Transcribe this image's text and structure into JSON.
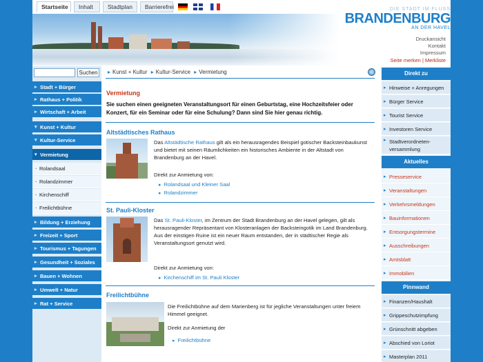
{
  "topnav": {
    "tabs": [
      "Startseite",
      "Inhalt",
      "Stadtplan",
      "Barrierefrei"
    ],
    "flags": [
      "flag-de-icon",
      "flag-uk-icon",
      "flag-fr-icon"
    ]
  },
  "logo": {
    "top": "DIE STADT IM FLUSS",
    "brand": "BRANDENBURG",
    "sub": "AN DER HAVEL"
  },
  "utility": [
    "Druckansicht",
    "Kontakt",
    "Impressum"
  ],
  "merk": {
    "a": "Seite merken",
    "sep": "|",
    "b": "Merkliste"
  },
  "search": {
    "button": "Suchen"
  },
  "leftnav": {
    "top": [
      "Stadt + Bürger",
      "Rathaus + Politik",
      "Wirtschaft + Arbeit",
      "Kunst + Kultur",
      "Kultur-Service",
      "Vermietung"
    ],
    "sub": [
      "Rolandsaal",
      "Rolandzimmer",
      "Kirchenschiff",
      "Freilichtbühne"
    ],
    "bottom": [
      "Bildung + Erziehung",
      "Freizeit + Sport",
      "Tourismus + Tagungen",
      "Gesundheit + Soziales",
      "Bauen + Wohnen",
      "Umwelt + Natur",
      "Rat + Service"
    ]
  },
  "breadcrumb": [
    "Kunst + Kultur",
    "Kultur-Service",
    "Vermietung"
  ],
  "main": {
    "title": "Vermietung",
    "intro": "Sie suchen einen geeigneten Veranstaltungsort für einen Geburtstag, eine Hochzeitsfeier oder Konzert, für ein Seminar oder für eine Schulung? Dann sind Sie hier genau richtig.",
    "s1": {
      "title": "Altstädtisches Rathaus",
      "pre": "Das ",
      "link": "Altstädtische Rathaus",
      "post": " gilt als ein herausragendes Beispiel gotischer Backsteinbaukunst und bietet mit seinen Räumlichkeiten ein historisches Ambiente in der Altstadt von Brandenburg an der Havel.",
      "direkt": "Direkt zur Anmietung von:",
      "links": [
        "Rolandsaal und Kleiner Saal",
        "Rolandzimmer"
      ]
    },
    "s2": {
      "title": "St. Pauli-Kloster",
      "pre": "Das ",
      "link": "St. Pauli-Kloster",
      "post": ", im Zentrum der Stadt Brandenburg an der Havel gelegen, gilt als herausragender Repräsentant von Klosteranlagen der Backsteingotik im Land Brandenburg. Aus der einstigen Ruine ist ein neuer Raum entstanden, der in städtischer Regie als Veranstaltungsort genutzt wird.",
      "direkt": "Direkt zur Anmietung von:",
      "links": [
        "Kirchenschiff im St. Pauli Kloster"
      ]
    },
    "s3": {
      "title": "Freilichtbühne",
      "text": "Die Freilichtbühne auf dem Marienberg ist für jegliche Veranstaltungen unter freiem Himmel geeignet.",
      "direkt": "Direkt zur Anmietung der",
      "links": [
        "Freilichtbühne"
      ]
    }
  },
  "right": {
    "direkt_head": "Direkt zu",
    "direkt": [
      "Hinweise + Anregungen",
      "Bürger Service",
      "Tourist Service",
      "Investoren Service",
      "Stadtverordneten-versammlung"
    ],
    "aktuelles_head": "Aktuelles",
    "aktuelles": [
      "Presseservice",
      "Veranstaltungen",
      "Verkehrsmeldungen",
      "Bauinformationen",
      "Entsorgungstermine",
      "Ausschreibungen",
      "Amtsblatt",
      "Immobilien"
    ],
    "pinnwand_head": "Pinnwand",
    "pinnwand": [
      "Finanzen/Haushalt",
      "Grippeschutzimpfung",
      "Grünschnitt abgeben",
      "Abschied von Loriot",
      "Masterplan 2011"
    ]
  },
  "colors": {
    "brand_blue": "#1e7fc8",
    "accent_red": "#c6361a"
  }
}
